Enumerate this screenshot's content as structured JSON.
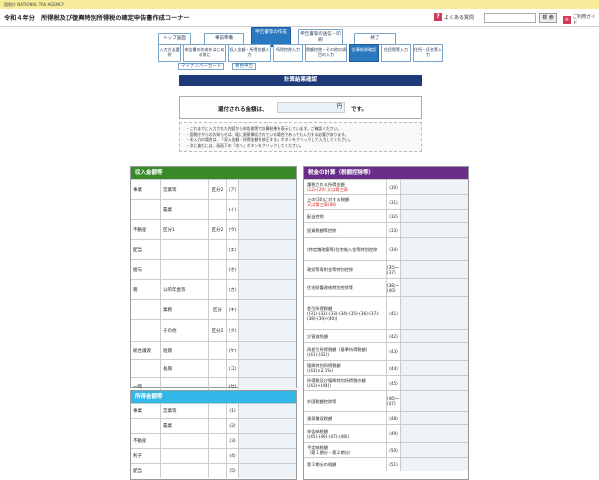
{
  "header": {
    "agency": "国税庁 NATIONAL TAX AGENCY",
    "title": "令和４年分　所得税及び復興特別所得税の確定申告書作成コーナー",
    "faq_label": "よくある質問",
    "search_button": "検 索",
    "guide_label": "ご利用ガイド"
  },
  "steps": [
    {
      "label": "トップ画面"
    },
    {
      "label": "事前準備"
    },
    {
      "label": "申告書等の作成"
    },
    {
      "label": "申告書等の送信・印刷"
    },
    {
      "label": "終了"
    }
  ],
  "substeps": [
    {
      "label": "入力方法選択"
    },
    {
      "label": "申告書の作成をはじめる前に"
    },
    {
      "label": "収入金額・所得金額入力"
    },
    {
      "label": "所得控除入力"
    },
    {
      "label": "税額控除・その他の項目の入力"
    },
    {
      "label": "計算結果確認"
    },
    {
      "label": "住民税等入力"
    },
    {
      "label": "住所・氏名等入力"
    }
  ],
  "sublinks": [
    "マイナンバーカード",
    "青色申告"
  ],
  "page_heading": "計算結果確認",
  "refund": {
    "label": "還付される金額は、",
    "unit": "円",
    "suffix": "です。"
  },
  "notes": [
    "これまでに入力された内容から申告書等で計算結果を表示しています。ご確認ください。",
    "国税庁からのお知らせは、既に源泉徴収されている場合であっても入力する必要があります。",
    "未入力の場合は、「収入金額・所得金額を修正する」ボタンをクリックして入力してください。",
    "次に進むには、画面下の「次へ」ボタンをクリックしてください。"
  ],
  "income_panel": {
    "title": "収入金額等",
    "rows": [
      {
        "c1": "事業",
        "c2": "営業等",
        "c3": "区分2",
        "num": "(ア)"
      },
      {
        "c1": "",
        "c2": "農業",
        "c3": "",
        "num": "(イ)"
      },
      {
        "c1": "不動産",
        "c2": "区分1",
        "c3": "区分2",
        "num": "(ウ)"
      },
      {
        "c1": "配当",
        "c2": "",
        "c3": "",
        "num": "(エ)"
      },
      {
        "c1": "給与",
        "c2": "",
        "c3": "",
        "num": "(オ)"
      },
      {
        "c1": "雑",
        "c2": "公的年金等",
        "c3": "",
        "num": "(カ)"
      },
      {
        "c1": "",
        "c2": "業務",
        "c3": "区分",
        "num": "(キ)"
      },
      {
        "c1": "",
        "c2": "その他",
        "c3": "区分2",
        "num": "(ク)"
      },
      {
        "c1": "総合譲渡",
        "c2": "短期",
        "c3": "",
        "num": "(ケ)"
      },
      {
        "c1": "",
        "c2": "長期",
        "c3": "",
        "num": "(コ)"
      },
      {
        "c1": "一時",
        "c2": "",
        "c3": "",
        "num": "(サ)"
      }
    ]
  },
  "shotoku_panel": {
    "title": "所得金額等",
    "rows": [
      {
        "c1": "事業",
        "c2": "営業等",
        "num": "(1)"
      },
      {
        "c1": "",
        "c2": "農業",
        "num": "(2)"
      },
      {
        "c1": "不動産",
        "c2": "",
        "num": "(3)"
      },
      {
        "c1": "利子",
        "c2": "",
        "num": "(4)"
      },
      {
        "c1": "配当",
        "c2": "",
        "num": "(5)"
      }
    ]
  },
  "tax_panel": {
    "title": "税金の計算（税額控除等）",
    "rows": [
      {
        "label": "課税される所得金額",
        "sub": "(12)-(29) 又は第三表",
        "num": "(30)",
        "red": true
      },
      {
        "label": "上の(30)に対する税額",
        "sub": "又は第三表(86)",
        "num": "(31)",
        "red": true
      },
      {
        "label": "配当控除",
        "sub": "",
        "num": "(32)"
      },
      {
        "label": "投資税額等控除",
        "sub": "",
        "num": "(33)"
      },
      {
        "label": "(特定増改築等)住宅借入金等特別控除",
        "sub": "",
        "num": "(34)"
      },
      {
        "label": "政党等寄附金等特別控除",
        "sub": "",
        "num": "(35)~(37)"
      },
      {
        "label": "住宅耐震改修特別控除等",
        "sub": "",
        "num": "(38)~(40)"
      },
      {
        "label": "差引所得税額",
        "sub": "((31)-(32)-(33)-(34)-(35)-(36)-(37)-(38)-(39)-(40))",
        "num": "(41)"
      },
      {
        "label": "災害減免額",
        "sub": "",
        "num": "(42)"
      },
      {
        "label": "再差引所得税額（基準所得税額）",
        "sub": "((41)-(42))",
        "num": "(43)"
      },
      {
        "label": "復興特別所得税額",
        "sub": "((43)×2.1%)",
        "num": "(44)"
      },
      {
        "label": "所得税及び復興特別所得税の額",
        "sub": "((43)+(44))",
        "num": "(45)"
      },
      {
        "label": "外国税額控除等",
        "sub": "",
        "num": "(46)~(47)"
      },
      {
        "label": "源泉徴収税額",
        "sub": "",
        "num": "(48)"
      },
      {
        "label": "申告納税額",
        "sub": "((45)-(46)-(47)-(48))",
        "num": "(49)"
      },
      {
        "label": "予定納税額",
        "sub": "（第１期分・第２期分）",
        "num": "(50)"
      },
      {
        "label": "第３期分の税額",
        "sub": "",
        "num": "(51)"
      }
    ]
  }
}
